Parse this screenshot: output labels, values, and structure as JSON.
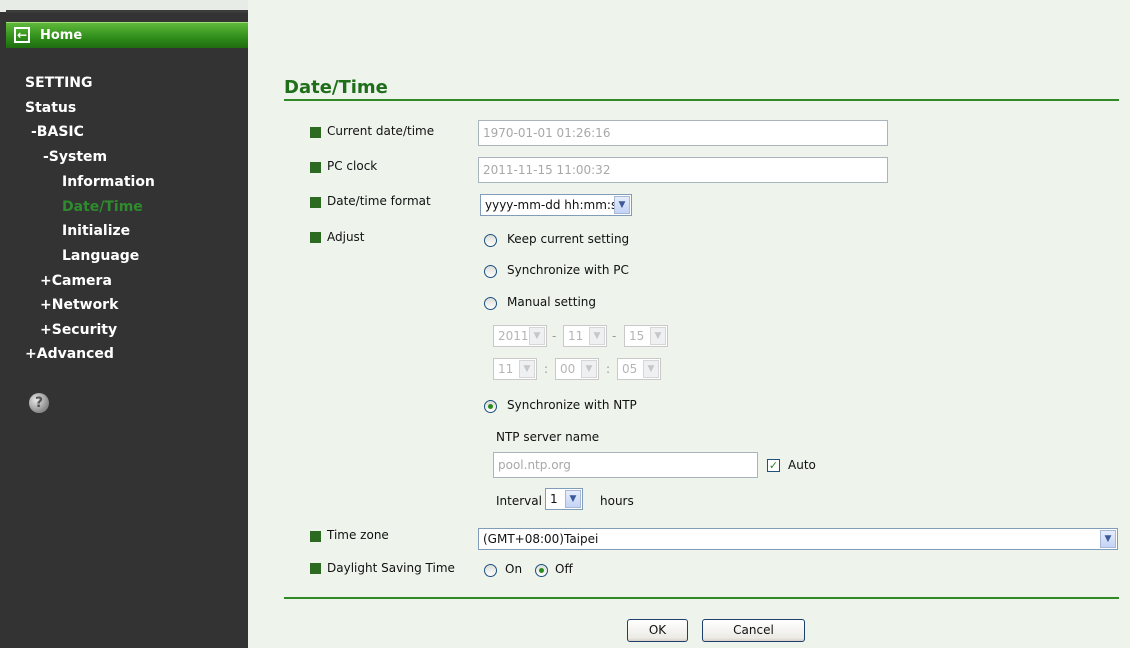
{
  "sidebar": {
    "home_label": "Home",
    "nav": {
      "setting": "SETTING",
      "status": "Status",
      "basic": "-BASIC",
      "system": "-System",
      "information": "Information",
      "datetime": "Date/Time",
      "initialize": "Initialize",
      "language": "Language",
      "camera": "+Camera",
      "network": "+Network",
      "security": "+Security",
      "advanced": "+Advanced"
    },
    "active_item": "Date/Time",
    "help_glyph": "?"
  },
  "page": {
    "title": "Date/Time",
    "current_datetime": {
      "label": "Current date/time",
      "value": "1970-01-01   01:26:16"
    },
    "pc_clock": {
      "label": "PC clock",
      "value": "2011-11-15   11:00:32"
    },
    "format": {
      "label": "Date/time format",
      "value": "yyyy-mm-dd hh:mm:ss"
    },
    "adjust": {
      "label": "Adjust",
      "options": {
        "keep": "Keep current setting",
        "sync_pc": "Synchronize with PC",
        "manual": "Manual setting",
        "ntp": "Synchronize with NTP"
      },
      "selected": "Synchronize with NTP",
      "manual_date": {
        "year": "2011",
        "month": "11",
        "day": "15",
        "separator": "-"
      },
      "manual_time": {
        "hour": "11",
        "minute": "00",
        "second": "05",
        "separator": ":"
      },
      "ntp_server_label": "NTP server name",
      "ntp_server_value": "pool.ntp.org",
      "auto_label": "Auto",
      "auto_checked": true,
      "interval_label": "Interval",
      "interval_value": "1",
      "interval_unit": "hours"
    },
    "time_zone": {
      "label": "Time zone",
      "value": "(GMT+08:00)Taipei"
    },
    "dst": {
      "label": "Daylight Saving Time",
      "on_label": "On",
      "off_label": "Off",
      "selected": "Off"
    }
  },
  "buttons": {
    "ok": "OK",
    "cancel": "Cancel"
  },
  "colors": {
    "accent_green": "#2f8a25",
    "sidebar_bg": "#333333",
    "page_bg": "#eef3ec"
  }
}
